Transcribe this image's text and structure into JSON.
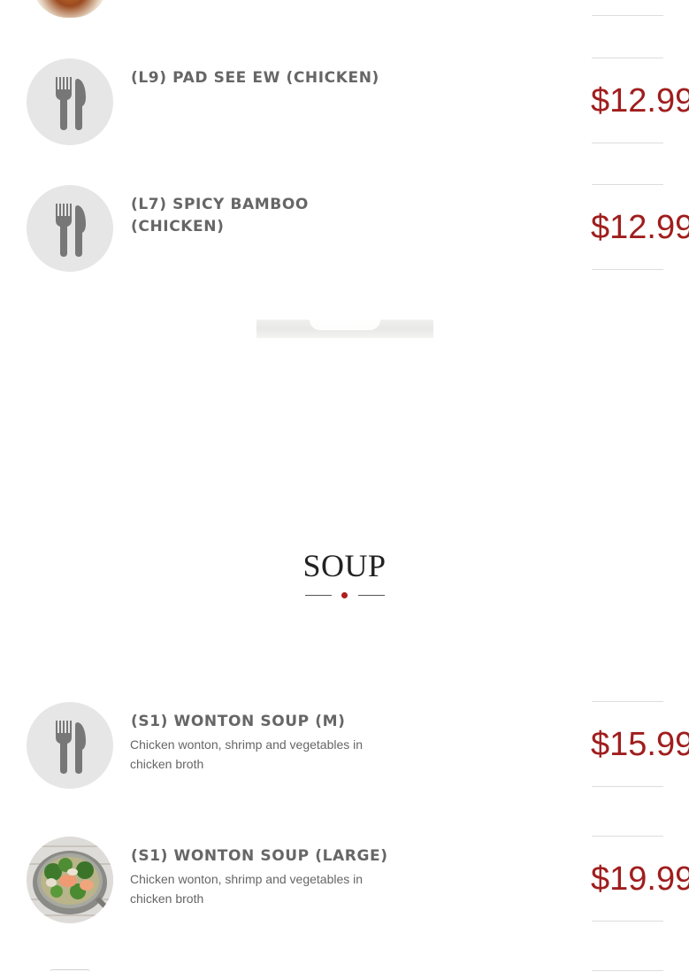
{
  "menu_items": [
    {
      "name": "(L9) PAD SEE EW (CHICKEN)",
      "description": "",
      "price": "$12.99",
      "image": "fork-knife-icon"
    },
    {
      "name": "(L7) SPICY BAMBOO (CHICKEN)",
      "description": "",
      "price": "$12.99",
      "image": "fork-knife-icon"
    }
  ],
  "section": {
    "title": "SOUP",
    "accent_color": "#b01c1c"
  },
  "soup_items": [
    {
      "name": "(S1) WONTON SOUP (M)",
      "description": "Chicken wonton, shrimp and vegetables in chicken broth",
      "price": "$15.99",
      "image": "fork-knife-icon"
    },
    {
      "name": "(S1) WONTON SOUP (LARGE)",
      "description": "Chicken wonton, shrimp and vegetables in chicken broth",
      "price": "$19.99",
      "image": "wonton-soup-photo"
    }
  ],
  "colors": {
    "price": "#a01e1e",
    "name": "#666666",
    "placeholder_bg": "#e6e6e6",
    "placeholder_icon": "#777777"
  }
}
